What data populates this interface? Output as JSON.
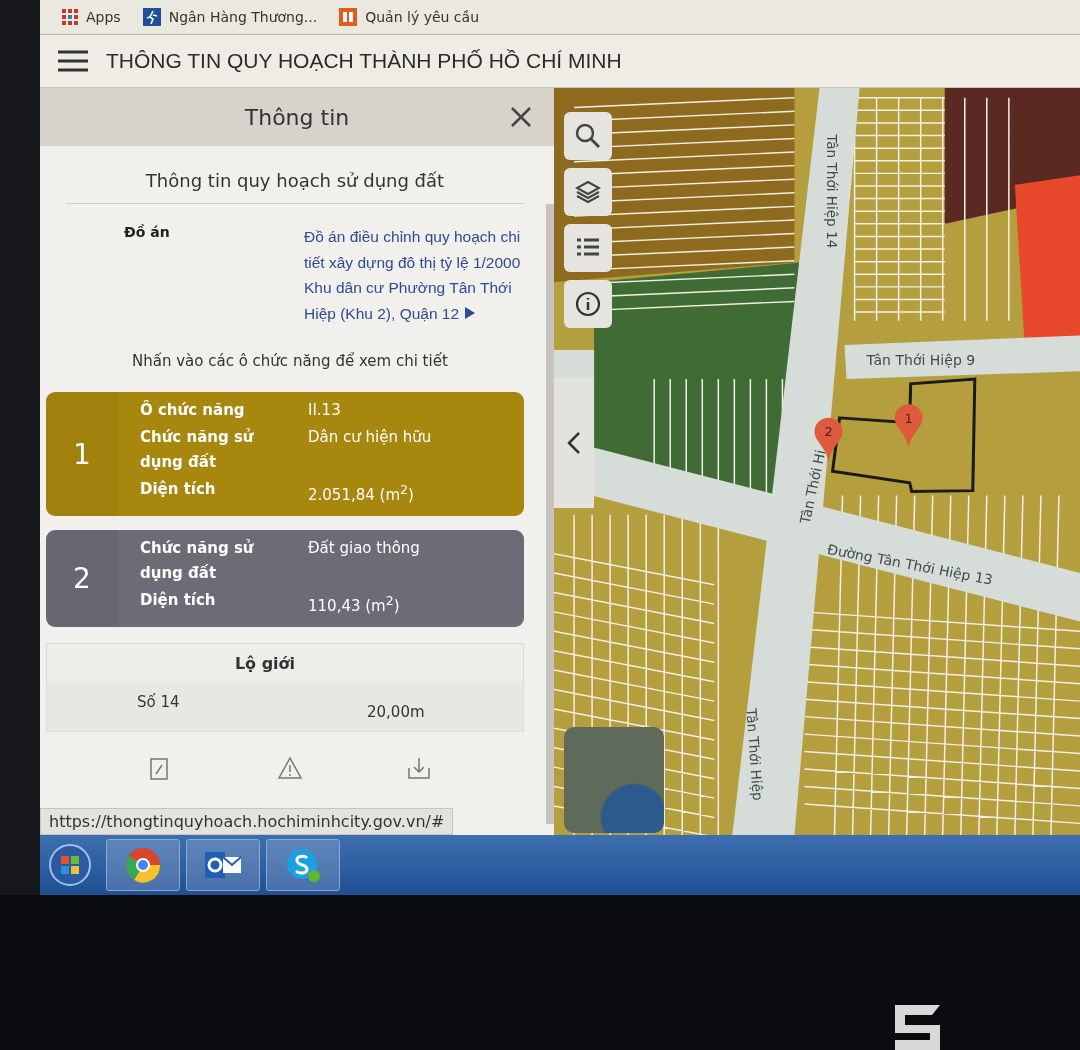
{
  "bookmarks": [
    {
      "label": "Apps",
      "kind": "apps"
    },
    {
      "label": "Ngân Hàng Thương...",
      "kind": "bank"
    },
    {
      "label": "Quản lý yêu cầu",
      "kind": "request"
    }
  ],
  "header": {
    "title": "THÔNG TIN QUY HOẠCH THÀNH PHỐ HỒ CHÍ MINH"
  },
  "panel": {
    "title": "Thông tin",
    "section_title": "Thông tin quy hoạch sử dụng đất",
    "project": {
      "label": "Đồ án",
      "value": "Đồ án điều chỉnh quy hoạch chi tiết xây dựng đô thị tỷ lệ 1/2000 Khu dân cư Phường Tân Thới Hiệp (Khu 2), Quận 12"
    },
    "hint": "Nhấn vào các ô chức năng để xem chi tiết",
    "cards": [
      {
        "number": "1",
        "color": "#a8870f",
        "rows": [
          {
            "label": "Ô chức năng",
            "value": "II.13"
          },
          {
            "label": "Chức năng sử dụng đất",
            "value": "Dân cư hiện hữu"
          },
          {
            "label": "Diện tích",
            "value": "2.051,84 (m$^{2}$)"
          }
        ]
      },
      {
        "number": "2",
        "color": "#6c6c76",
        "rows": [
          {
            "label": "Chức năng sử dụng đất",
            "value": "Đất giao thông"
          },
          {
            "label": "Diện tích",
            "value": "110,43 (m$^{2}$)"
          }
        ]
      }
    ],
    "boundary": {
      "title": "Lộ giới",
      "rows": [
        {
          "name": "Số 14",
          "value": "20,00m"
        }
      ]
    }
  },
  "status_url": "https://thongtinquyhoach.hochiminhcity.gov.vn/#",
  "map": {
    "roads": [
      {
        "label": "Tân Thới Hiệp 14",
        "kind": "vertical"
      },
      {
        "label": "Tân Thới Hiệp 9",
        "kind": "east"
      },
      {
        "label": "Tân Thới Hi",
        "kind": "short"
      },
      {
        "label": "Đường Tân Thới Hiệp 13",
        "kind": "diagonal"
      },
      {
        "label": "Tân Thới Hiệp",
        "kind": "south"
      }
    ],
    "markers": [
      {
        "label": "1"
      },
      {
        "label": "2"
      }
    ]
  }
}
